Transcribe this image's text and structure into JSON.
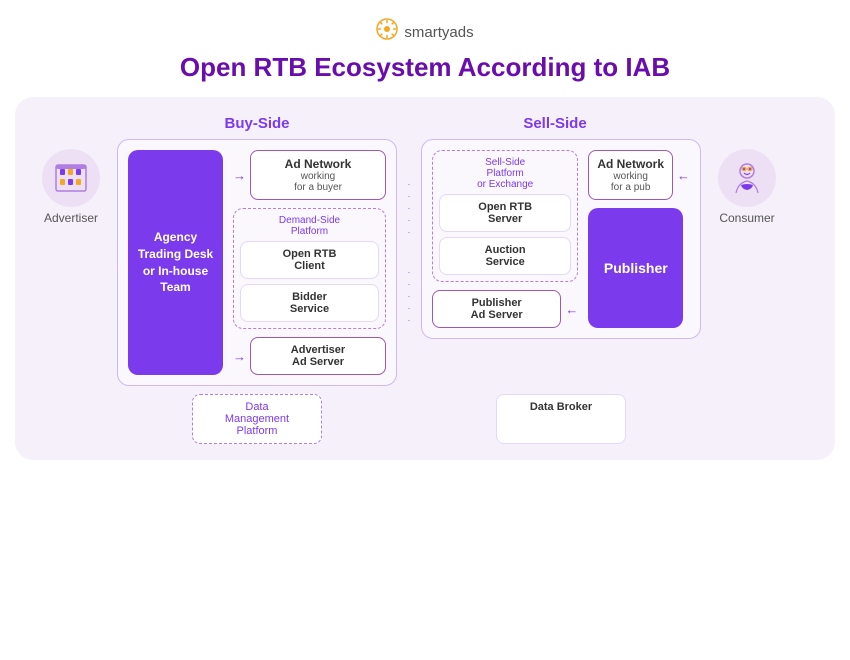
{
  "logo": {
    "icon": "💡",
    "text": "smartyads"
  },
  "title": "Open RTB Ecosystem According to IAB",
  "sections": {
    "buy": "Buy-Side",
    "sell": "Sell-Side"
  },
  "advertiser": {
    "icon": "🏢",
    "label": "Advertiser"
  },
  "consumer": {
    "icon": "👤",
    "label": "Consumer"
  },
  "agency_block": "Agency\nTrading Desk\nor In-house\nTeam",
  "publisher_block": "Publisher",
  "buy_side": {
    "ad_network": {
      "title": "Ad Network",
      "sub": "working\nfor a buyer"
    },
    "dsp_label": "Demand-Side\nPlatform",
    "open_rtb_client": "Open RTB\nClient",
    "bidder_service": "Bidder\nService",
    "advertiser_ad_server": "Advertiser\nAd Server",
    "dmp": "Data\nManagement\nPlatform"
  },
  "sell_side": {
    "ssp_label": "Sell-Side\nPlatform\nor Exchange",
    "open_rtb_server": "Open RTB\nServer",
    "auction_service": "Auction\nService",
    "ad_network": {
      "title": "Ad Network",
      "sub": "working\nfor a pub"
    },
    "publisher_ad_server": "Publisher\nAd Server",
    "data_broker": "Data Broker"
  }
}
